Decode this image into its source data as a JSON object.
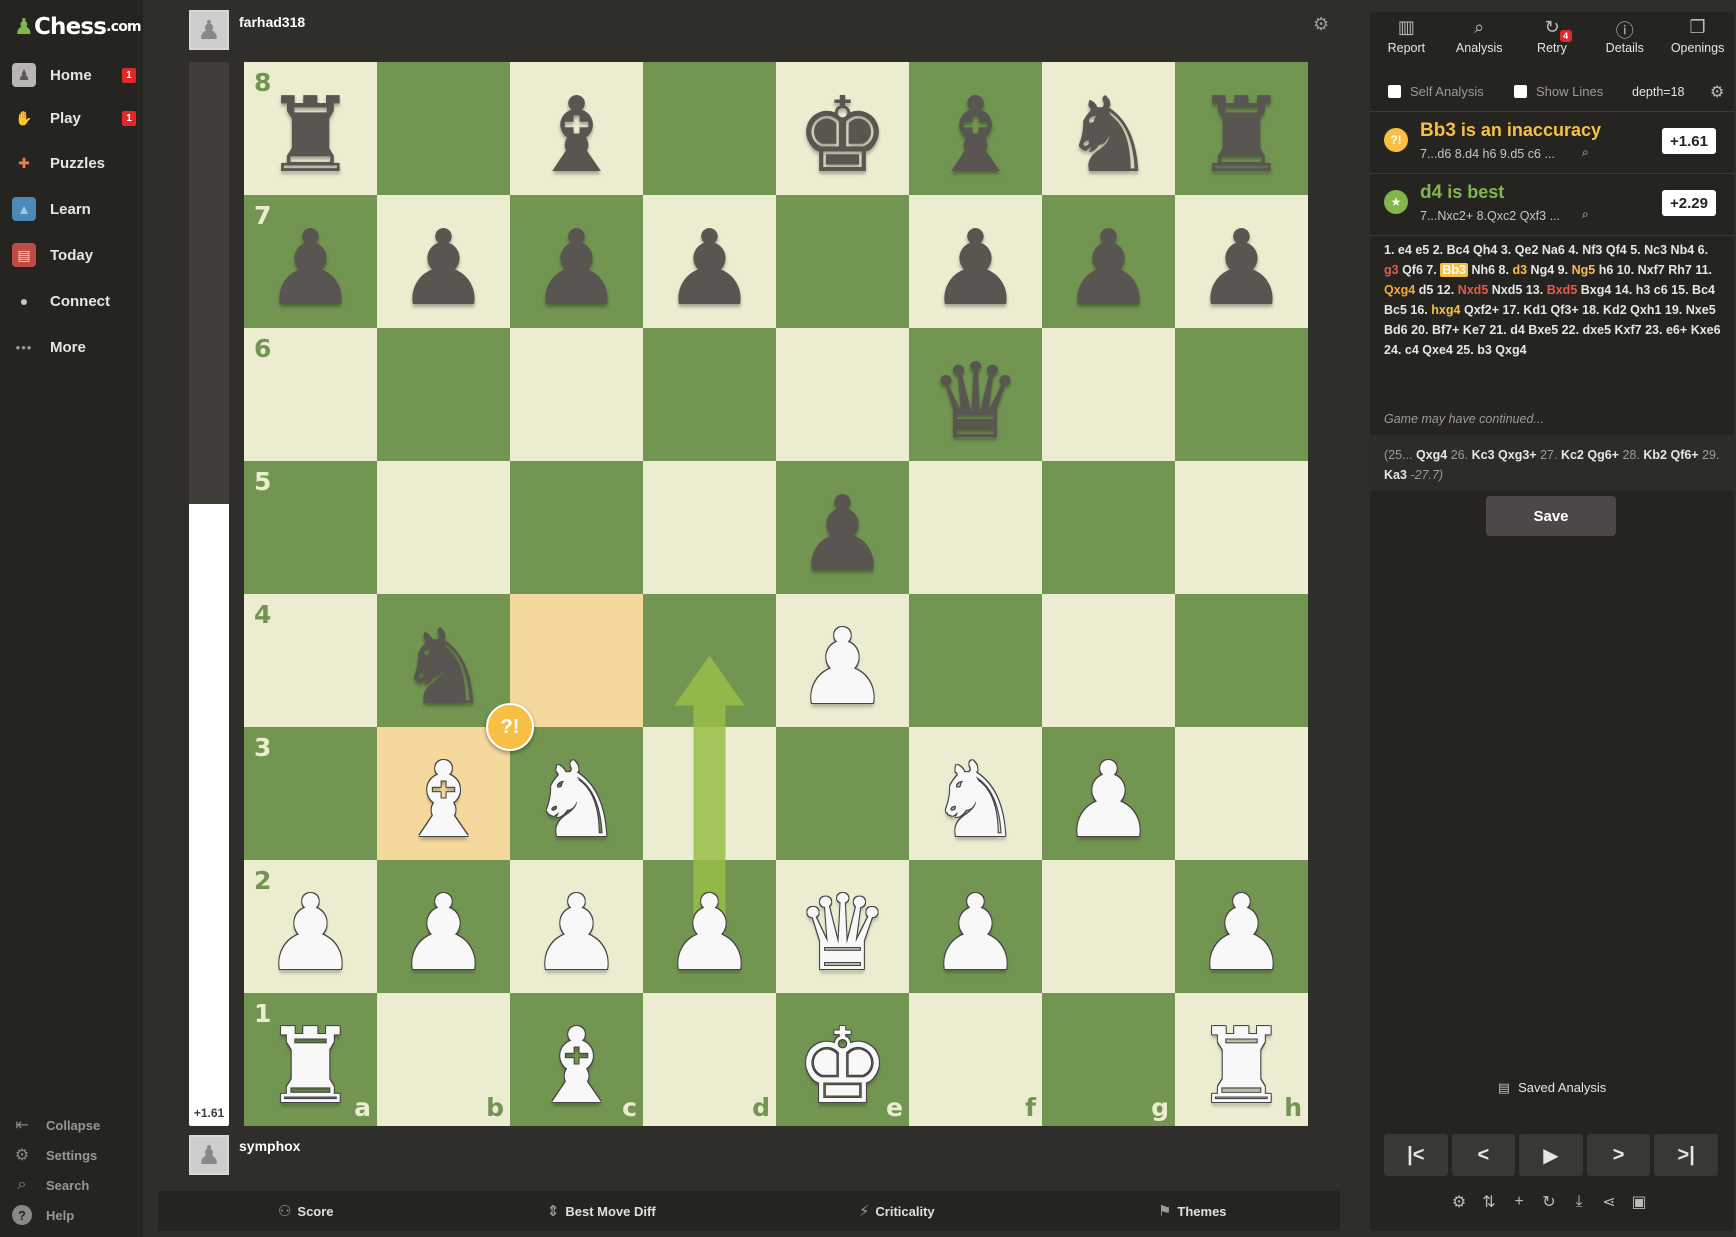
{
  "app": {
    "logo_text": "Chess",
    "logo_suffix": ".com"
  },
  "sidebar": {
    "items": [
      {
        "label": "Home",
        "badge": "1",
        "icon": "home-icon"
      },
      {
        "label": "Play",
        "badge": "1",
        "icon": "play-icon"
      },
      {
        "label": "Puzzles",
        "badge": "",
        "icon": "puzzle-icon"
      },
      {
        "label": "Learn",
        "badge": "",
        "icon": "learn-icon"
      },
      {
        "label": "Today",
        "badge": "",
        "icon": "news-icon"
      },
      {
        "label": "Connect",
        "badge": "",
        "icon": "chat-icon"
      },
      {
        "label": "More",
        "badge": "",
        "icon": "more-icon"
      }
    ],
    "bottom": [
      {
        "label": "Collapse",
        "icon": "collapse-icon"
      },
      {
        "label": "Settings",
        "icon": "settings-icon"
      },
      {
        "label": "Search",
        "icon": "search-icon"
      },
      {
        "label": "Help",
        "icon": "help-icon"
      }
    ]
  },
  "players": {
    "top": {
      "name": "farhad318"
    },
    "bottom": {
      "name": "symphox"
    }
  },
  "eval_bar": {
    "label": "+1.61",
    "white_fraction": 0.585
  },
  "board": {
    "ranks": [
      "8",
      "7",
      "6",
      "5",
      "4",
      "3",
      "2",
      "1"
    ],
    "files": [
      "a",
      "b",
      "c",
      "d",
      "e",
      "f",
      "g",
      "h"
    ],
    "highlight_squares": [
      "b3",
      "c4"
    ],
    "arrow": {
      "from": "d2",
      "to": "d4",
      "color": "#96be46"
    },
    "marker": {
      "square": "b3",
      "symbol": "?!",
      "color": "#f7c045"
    },
    "pieces": [
      {
        "sq": "a8",
        "p": "r"
      },
      {
        "sq": "c8",
        "p": "b"
      },
      {
        "sq": "e8",
        "p": "k"
      },
      {
        "sq": "f8",
        "p": "b"
      },
      {
        "sq": "g8",
        "p": "n"
      },
      {
        "sq": "h8",
        "p": "r"
      },
      {
        "sq": "a7",
        "p": "p"
      },
      {
        "sq": "b7",
        "p": "p"
      },
      {
        "sq": "c7",
        "p": "p"
      },
      {
        "sq": "d7",
        "p": "p"
      },
      {
        "sq": "f7",
        "p": "p"
      },
      {
        "sq": "g7",
        "p": "p"
      },
      {
        "sq": "h7",
        "p": "p"
      },
      {
        "sq": "f6",
        "p": "q"
      },
      {
        "sq": "e5",
        "p": "p"
      },
      {
        "sq": "b4",
        "p": "n"
      },
      {
        "sq": "e4",
        "p": "P"
      },
      {
        "sq": "b3",
        "p": "B"
      },
      {
        "sq": "c3",
        "p": "N"
      },
      {
        "sq": "f3",
        "p": "N"
      },
      {
        "sq": "g3",
        "p": "P"
      },
      {
        "sq": "a2",
        "p": "P"
      },
      {
        "sq": "b2",
        "p": "P"
      },
      {
        "sq": "c2",
        "p": "P"
      },
      {
        "sq": "d2",
        "p": "P"
      },
      {
        "sq": "e2",
        "p": "Q"
      },
      {
        "sq": "f2",
        "p": "P"
      },
      {
        "sq": "h2",
        "p": "P"
      },
      {
        "sq": "a1",
        "p": "R"
      },
      {
        "sq": "c1",
        "p": "B"
      },
      {
        "sq": "e1",
        "p": "K"
      },
      {
        "sq": "h1",
        "p": "R"
      }
    ]
  },
  "bottom_bar": [
    {
      "label": "Score",
      "icon": "users-icon"
    },
    {
      "label": "Best Move Diff",
      "icon": "sort-icon"
    },
    {
      "label": "Criticality",
      "icon": "bolt-icon"
    },
    {
      "label": "Themes",
      "icon": "themes-icon"
    }
  ],
  "panel": {
    "tabs": [
      {
        "label": "Report",
        "icon": "report-icon"
      },
      {
        "label": "Analysis",
        "icon": "analysis-icon"
      },
      {
        "label": "Retry",
        "icon": "retry-icon",
        "badge": "4"
      },
      {
        "label": "Details",
        "icon": "info-icon"
      },
      {
        "label": "Openings",
        "icon": "book-icon"
      }
    ],
    "options": {
      "self_analysis": "Self Analysis",
      "show_lines": "Show Lines",
      "depth": "depth=18"
    },
    "evaluations": [
      {
        "move": "Bb3",
        "text": " is an inaccuracy",
        "line": "7...d6 8.d4 h6 9.d5 c6 ...",
        "score": "+1.61",
        "color": "#f7c045",
        "icon": "?!"
      },
      {
        "move": "d4",
        "text": " is best",
        "line": "7...Nxc2+ 8.Qxc2 Qxf3 ...",
        "score": "+2.29",
        "color": "#81b64c",
        "icon": "★"
      }
    ],
    "moves": [
      {
        "t": "1.",
        "c": "num"
      },
      {
        "t": "e4"
      },
      {
        "t": "e5"
      },
      {
        "t": "2.",
        "c": "num"
      },
      {
        "t": "Bc4"
      },
      {
        "t": "Qh4"
      },
      {
        "t": "3.",
        "c": "num"
      },
      {
        "t": "Qe2"
      },
      {
        "t": "Na6"
      },
      {
        "t": "4.",
        "c": "num"
      },
      {
        "t": "Nf3"
      },
      {
        "t": "Qf4"
      },
      {
        "t": "5.",
        "c": "num"
      },
      {
        "t": "Nc3"
      },
      {
        "t": "Nb4"
      },
      {
        "t": "6.",
        "c": "num"
      },
      {
        "t": "g3",
        "c": "red"
      },
      {
        "t": "Qf6"
      },
      {
        "t": "7.",
        "c": "num"
      },
      {
        "t": "Bb3",
        "c": "cur"
      },
      {
        "t": "Nh6"
      },
      {
        "t": "8.",
        "c": "num"
      },
      {
        "t": "d3",
        "c": "yellow"
      },
      {
        "t": "Ng4"
      },
      {
        "t": "9.",
        "c": "num"
      },
      {
        "t": "Ng5",
        "c": "yellow"
      },
      {
        "t": "h6"
      },
      {
        "t": "10.",
        "c": "num"
      },
      {
        "t": "Nxf7"
      },
      {
        "t": "Rh7"
      },
      {
        "t": "11.",
        "c": "num"
      },
      {
        "t": "Qxg4",
        "c": "orange"
      },
      {
        "t": "d5"
      },
      {
        "t": "12.",
        "c": "num"
      },
      {
        "t": "Nxd5",
        "c": "red"
      },
      {
        "t": "Nxd5"
      },
      {
        "t": "13.",
        "c": "num"
      },
      {
        "t": "Bxd5",
        "c": "red"
      },
      {
        "t": "Bxg4"
      },
      {
        "t": "14.",
        "c": "num"
      },
      {
        "t": "h3"
      },
      {
        "t": "c6"
      },
      {
        "t": "15.",
        "c": "num"
      },
      {
        "t": "Bc4"
      },
      {
        "t": "Bc5"
      },
      {
        "t": "16.",
        "c": "num"
      },
      {
        "t": "hxg4",
        "c": "yellow"
      },
      {
        "t": "Qxf2+"
      },
      {
        "t": "17.",
        "c": "num"
      },
      {
        "t": "Kd1"
      },
      {
        "t": "Qf3+"
      },
      {
        "t": "18.",
        "c": "num"
      },
      {
        "t": "Kd2"
      },
      {
        "t": "Qxh1"
      },
      {
        "t": "19.",
        "c": "num"
      },
      {
        "t": "Nxe5"
      },
      {
        "t": "Bd6"
      },
      {
        "t": "20.",
        "c": "num"
      },
      {
        "t": "Bf7+"
      },
      {
        "t": "Ke7"
      },
      {
        "t": "21.",
        "c": "num"
      },
      {
        "t": "d4"
      },
      {
        "t": "Bxe5"
      },
      {
        "t": "22.",
        "c": "num"
      },
      {
        "t": "dxe5"
      },
      {
        "t": "Kxf7"
      },
      {
        "t": "23.",
        "c": "num"
      },
      {
        "t": "e6+"
      },
      {
        "t": "Kxe6"
      },
      {
        "t": "24.",
        "c": "num"
      },
      {
        "t": "c4"
      },
      {
        "t": "Qxe4"
      },
      {
        "t": "25.",
        "c": "num"
      },
      {
        "t": "b3"
      },
      {
        "t": "Qxg4"
      }
    ],
    "continued_note": "Game may have continued...",
    "continuation": [
      {
        "t": "(25...",
        "b": false
      },
      {
        "t": "Qxg4",
        "b": true
      },
      {
        "t": "26.",
        "b": false
      },
      {
        "t": "Kc3",
        "b": true
      },
      {
        "t": "Qxg3+",
        "b": true
      },
      {
        "t": "27.",
        "b": false
      },
      {
        "t": "Kc2",
        "b": true
      },
      {
        "t": "Qg6+",
        "b": true
      },
      {
        "t": "28.",
        "b": false
      },
      {
        "t": "Kb2",
        "b": true
      },
      {
        "t": "Qf6+",
        "b": true
      },
      {
        "t": "29.",
        "b": false
      },
      {
        "t": "Ka3",
        "b": true
      },
      {
        "t": "-27.7)",
        "b": false,
        "i": true
      }
    ],
    "save_label": "Save",
    "saved_analysis_label": "Saved Analysis",
    "nav_buttons": [
      {
        "name": "first-move-button",
        "glyph": "|<"
      },
      {
        "name": "prev-move-button",
        "glyph": "<"
      },
      {
        "name": "play-button",
        "glyph": "▶"
      },
      {
        "name": "next-move-button",
        "glyph": ">"
      },
      {
        "name": "last-move-button",
        "glyph": ">|"
      }
    ],
    "tools": [
      {
        "name": "engine-icon",
        "glyph": "⚙"
      },
      {
        "name": "flip-board-icon",
        "glyph": "⇅"
      },
      {
        "name": "add-icon",
        "glyph": "+"
      },
      {
        "name": "reset-icon",
        "glyph": "↻"
      },
      {
        "name": "download-icon",
        "glyph": "⤓"
      },
      {
        "name": "share-icon",
        "glyph": "⋖"
      },
      {
        "name": "present-icon",
        "glyph": "▣"
      }
    ]
  }
}
